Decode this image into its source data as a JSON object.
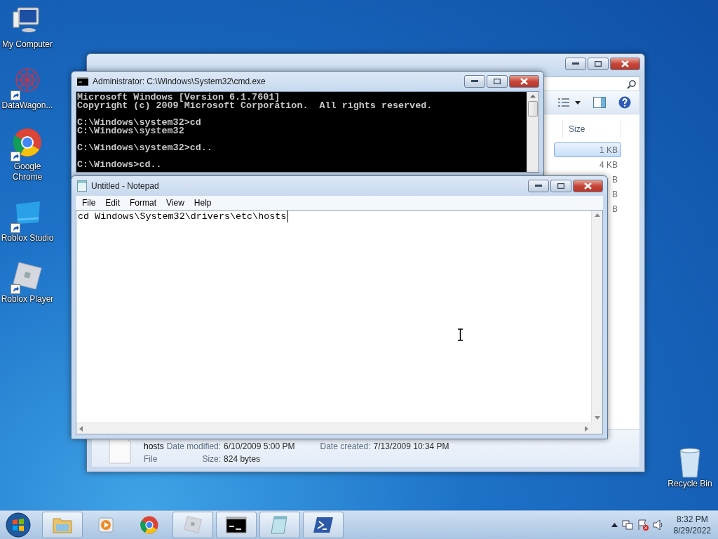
{
  "desktop_icons": [
    {
      "label": "My Computer",
      "kind": "computer",
      "shortcut": false
    },
    {
      "label": "DataWagon...",
      "kind": "network",
      "shortcut": true
    },
    {
      "label": "Google Chrome",
      "kind": "chrome",
      "shortcut": true
    },
    {
      "label": "Roblox Studio",
      "kind": "studio",
      "shortcut": true
    },
    {
      "label": "Roblox Player",
      "kind": "player",
      "shortcut": true
    }
  ],
  "recycle_bin": {
    "label": "Recycle Bin"
  },
  "explorer": {
    "column": "Size",
    "rows": [
      {
        "size": "1 KB",
        "selected": true
      },
      {
        "size": "4 KB",
        "selected": false
      },
      {
        "size": "B",
        "selected": false
      },
      {
        "size": "B",
        "selected": false
      },
      {
        "size": "B",
        "selected": false
      }
    ],
    "details": {
      "name": "hosts",
      "date_modified_label": "Date modified:",
      "date_modified": "6/10/2009 5:00 PM",
      "date_created_label": "Date created:",
      "date_created": "7/13/2009 10:34 PM",
      "type": "File",
      "size_label": "Size:",
      "size": "824 bytes"
    }
  },
  "cmd": {
    "title": "Administrator: C:\\Windows\\System32\\cmd.exe",
    "blocks": [
      [
        "Microsoft Windows [Version 6.1.7601]",
        "Copyright (c) 2009 Microsoft Corporation.  All rights reserved."
      ],
      [
        "C:\\Windows\\system32>cd",
        "C:\\Windows\\system32"
      ],
      [
        "C:\\Windows\\system32>cd.."
      ],
      [
        "C:\\Windows>cd.."
      ]
    ]
  },
  "notepad": {
    "title": "Untitled - Notepad",
    "menu": [
      "File",
      "Edit",
      "Format",
      "View",
      "Help"
    ],
    "text": "cd Windows\\System32\\drivers\\etc\\hosts"
  },
  "taskbar": {
    "items": [
      {
        "kind": "explorer",
        "open": true
      },
      {
        "kind": "media",
        "open": false
      },
      {
        "kind": "chrome",
        "open": false
      },
      {
        "kind": "player",
        "open": true
      },
      {
        "kind": "cmd",
        "open": true
      },
      {
        "kind": "notepad",
        "open": true
      },
      {
        "kind": "powershell",
        "open": true
      }
    ],
    "time": "8:32 PM",
    "date": "8/29/2022"
  }
}
